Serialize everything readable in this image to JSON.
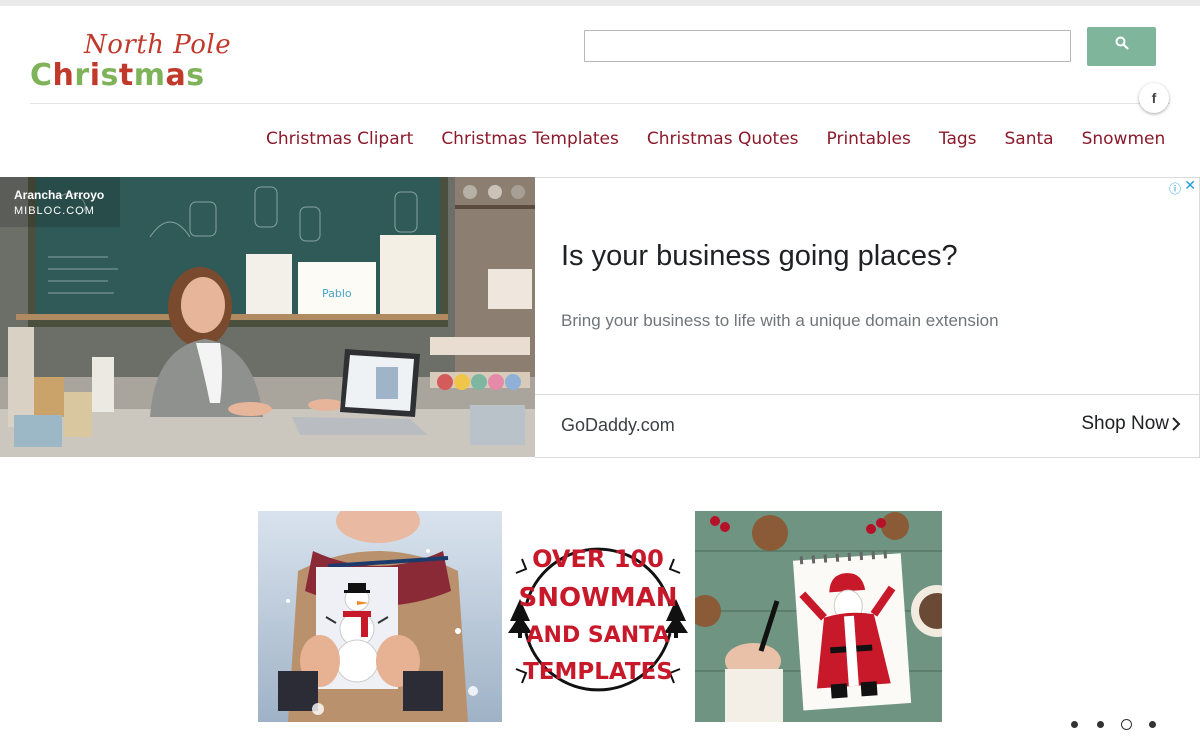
{
  "logo": {
    "line1": "North Pole",
    "line2": "Christmas"
  },
  "search": {
    "value": "",
    "placeholder": "",
    "icon": "search-icon",
    "button_color": "#7fb59a"
  },
  "social": {
    "facebook_label": "f"
  },
  "nav": {
    "items": [
      {
        "label": "Christmas Clipart"
      },
      {
        "label": "Christmas Templates"
      },
      {
        "label": "Christmas Quotes"
      },
      {
        "label": "Printables"
      },
      {
        "label": "Tags"
      },
      {
        "label": "Santa"
      },
      {
        "label": "Snowmen"
      }
    ],
    "color": "#8b1a2b"
  },
  "ad": {
    "credit_name": "Arancha Arroyo",
    "credit_site": "MIBLOC.COM",
    "headline": "Is your business going places?",
    "subtext": "Bring your business to life with a unique domain extension",
    "domain": "GoDaddy.com",
    "cta": "Shop Now",
    "info_icon": "ⓘ",
    "close_icon": "✕"
  },
  "slider": {
    "template_lines": [
      "OVER 100",
      "SNOWMAN",
      "AND SANTA",
      "TEMPLATES"
    ],
    "dot_count": 4,
    "active_dot": 3
  }
}
